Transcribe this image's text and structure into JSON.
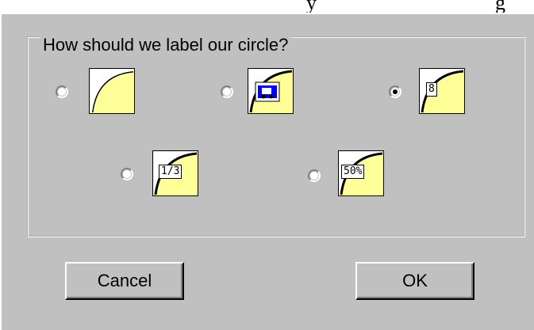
{
  "top_fragment": "y",
  "top_fragment_suffix": "g",
  "group": {
    "legend": "How should we label our circle?"
  },
  "options": [
    {
      "id": "none",
      "selected": false,
      "badge": ""
    },
    {
      "id": "picture",
      "selected": false,
      "badge": ""
    },
    {
      "id": "number",
      "selected": true,
      "badge": "8"
    },
    {
      "id": "fraction",
      "selected": false,
      "badge": "1/3"
    },
    {
      "id": "percent",
      "selected": false,
      "badge": "50%"
    }
  ],
  "buttons": {
    "cancel": "Cancel",
    "ok": "OK"
  },
  "colors": {
    "face": "#c0c0c0",
    "swatch": "#ffff99",
    "arc": "#000000"
  }
}
